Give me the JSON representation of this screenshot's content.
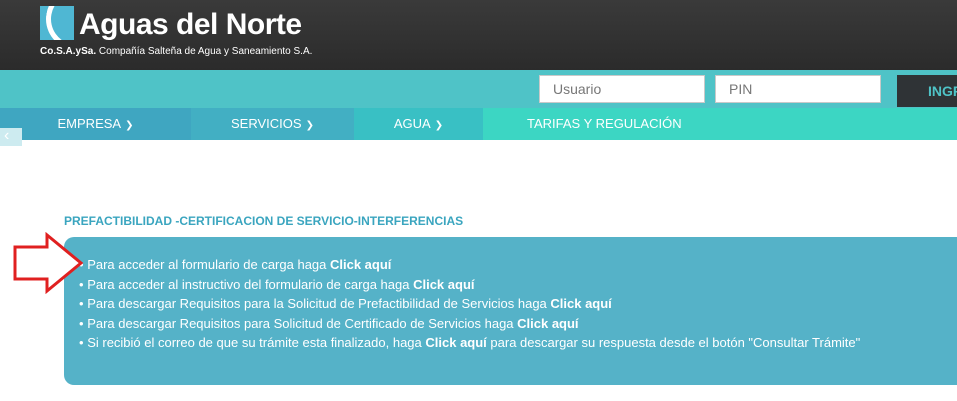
{
  "brand": {
    "title": "Aguas del Norte",
    "subtitle_abbr": "Co.S.A.ySa.",
    "subtitle_full": "Compañía Salteña de Agua y Saneamiento S.A.",
    "colors": {
      "dark": "#2f2f2f",
      "teal": "#4fc3c7",
      "accent": "#55b2c8"
    }
  },
  "login": {
    "user_placeholder": "Usuario",
    "pin_placeholder": "PIN",
    "button_label": "INGR"
  },
  "nav": {
    "items": [
      {
        "label": "EMPRESA",
        "icon": "chevron-down-icon"
      },
      {
        "label": "SERVICIOS",
        "icon": "chevron-down-icon"
      },
      {
        "label": "AGUA",
        "icon": "chevron-down-icon"
      },
      {
        "label": "TARIFAS Y REGULACIÓN"
      }
    ]
  },
  "section": {
    "title": "PREFACTIBILIDAD -CERTIFICACION DE SERVICIO-INTERFERENCIAS",
    "items": [
      {
        "text": "Para acceder al formulario de carga haga ",
        "link": "Click aquí",
        "after": ""
      },
      {
        "text": "Para acceder al instructivo del formulario de carga haga ",
        "link": "Click aquí",
        "after": ""
      },
      {
        "text": "Para descargar Requisitos para la Solicitud de Prefactibilidad de Servicios haga ",
        "link": "Click aquí",
        "after": ""
      },
      {
        "text": "Para descargar Requisitos para Solicitud de Certificado de Servicios haga ",
        "link": "Click aquí",
        "after": ""
      },
      {
        "text": "Si recibió el correo de que su trámite esta finalizado, haga ",
        "link": "Click aquí",
        "after": " para descargar su respuesta desde el botón \"Consultar Trámite\""
      }
    ],
    "bullet": "•"
  },
  "annotation": {
    "icon": "red-arrow-icon",
    "color": "#e02020"
  }
}
